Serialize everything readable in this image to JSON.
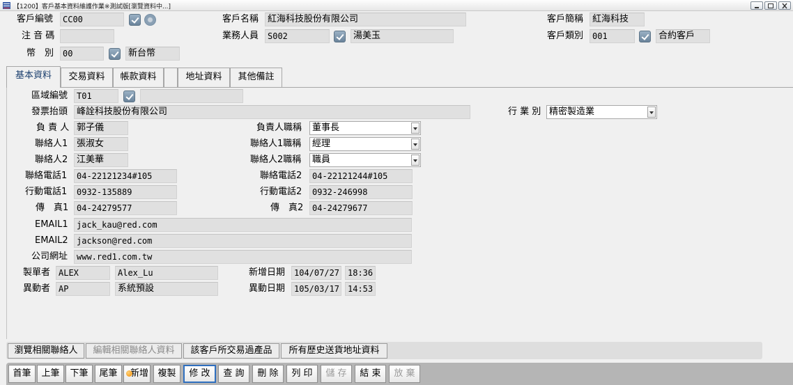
{
  "window": {
    "title": "【1200】客戶基本資料維護作業※測試版[瀏覽資料中...]"
  },
  "header": {
    "customer_code_label": "客戶編號",
    "customer_code": "CC00",
    "customer_name_label": "客戶名稱",
    "customer_name": "紅海科技股份有限公司",
    "customer_short_label": "客戶簡稱",
    "customer_short": "紅海科技",
    "phonetic_label": "注 音 碼",
    "phonetic": "",
    "sales_label": "業務人員",
    "sales_code": "S002",
    "sales_name": "湯美玉",
    "category_label": "客戶類別",
    "category_code": "001",
    "category_name": "合約客戶",
    "currency_label": "幣　別",
    "currency_code": "00",
    "currency_name": "新台幣"
  },
  "tabs": [
    {
      "label": "基本資料",
      "active": true
    },
    {
      "label": "交易資料",
      "active": false
    },
    {
      "label": "帳款資料",
      "active": false
    },
    {
      "label": "",
      "active": false
    },
    {
      "label": "地址資料",
      "active": false
    },
    {
      "label": "其他備註",
      "active": false
    }
  ],
  "form": {
    "region_label": "區域編號",
    "region_code": "T01",
    "region_name": "",
    "invoice_title_label": "發票抬頭",
    "invoice_title": "峰詮科技股份有限公司",
    "industry_label": "行 業 別",
    "industry": "精密製造業",
    "owner_label": "負 責 人",
    "owner": "郭子儀",
    "owner_title_label": "負責人職稱",
    "owner_title": "董事長",
    "contact1_label": "聯絡人1",
    "contact1": "張淑女",
    "contact1_title_label": "聯絡人1職稱",
    "contact1_title": "經理",
    "contact2_label": "聯絡人2",
    "contact2": "江美華",
    "contact2_title_label": "聯絡人2職稱",
    "contact2_title": "職員",
    "phone1_label": "聯絡電話1",
    "phone1": "04-22121234#105",
    "phone2_label": "聯絡電話2",
    "phone2": "04-22121244#105",
    "mobile1_label": "行動電話1",
    "mobile1": "0932-135889",
    "mobile2_label": "行動電話2",
    "mobile2": "0932-246998",
    "fax1_label": "傳　真1",
    "fax1": "04-24279577",
    "fax2_label": "傳　真2",
    "fax2": "04-24279677",
    "email1_label": "EMAIL1",
    "email1": "jack_kau@red.com",
    "email2_label": "EMAIL2",
    "email2": "jackson@red.com",
    "website_label": "公司網址",
    "website": "www.red1.com.tw",
    "creator_label": "製單者",
    "creator_code": "ALEX",
    "creator_name": "Alex_Lu",
    "created_label": "新增日期",
    "created_date": "104/07/27",
    "created_time": "18:36",
    "modifier_label": "異動者",
    "modifier_code": "AP",
    "modifier_name": "系統預設",
    "modified_label": "異動日期",
    "modified_date": "105/03/17",
    "modified_time": "14:53"
  },
  "sub_actions": [
    {
      "label": "瀏覽相關聯絡人",
      "enabled": true
    },
    {
      "label": "編輯相關聯絡人資料",
      "enabled": false
    },
    {
      "label": "該客戶所交易過產品",
      "enabled": true
    },
    {
      "label": "所有歷史送貨地址資料",
      "enabled": true
    }
  ],
  "toolbar": [
    {
      "label": "首筆",
      "enabled": true
    },
    {
      "label": "上筆",
      "enabled": true
    },
    {
      "label": "下筆",
      "enabled": true
    },
    {
      "label": "尾筆",
      "enabled": true
    },
    {
      "label": "新增",
      "enabled": true,
      "icon": "add-icon"
    },
    {
      "label": "複製",
      "enabled": true
    },
    {
      "label": "修 改",
      "enabled": true,
      "active": true
    },
    {
      "label": "查 詢",
      "enabled": true
    },
    {
      "label": "刪 除",
      "enabled": true
    },
    {
      "label": "列 印",
      "enabled": true
    },
    {
      "label": "儲 存",
      "enabled": false
    },
    {
      "label": "結 束",
      "enabled": true
    },
    {
      "label": "放 棄",
      "enabled": false
    }
  ],
  "colors": {
    "field_bg": "#e0e0e0",
    "active_tab_text": "#1b3f6e",
    "active_button_border": "#2f6fbf",
    "toolbar_bg": "#b5b5b5"
  }
}
